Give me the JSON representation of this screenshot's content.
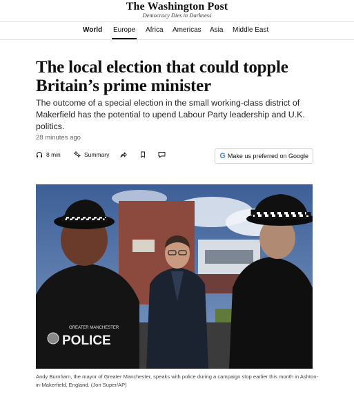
{
  "masthead": {
    "logo": "The Washington Post",
    "tagline": "Democracy Dies in Darkness"
  },
  "nav": {
    "items": [
      {
        "label": "World",
        "bold": true,
        "active": false
      },
      {
        "label": "Europe",
        "bold": false,
        "active": true
      },
      {
        "label": "Africa",
        "bold": false,
        "active": false
      },
      {
        "label": "Americas",
        "bold": false,
        "active": false
      },
      {
        "label": "Asia",
        "bold": false,
        "active": false
      },
      {
        "label": "Middle East",
        "bold": false,
        "active": false
      }
    ]
  },
  "article": {
    "headline": "The local election that could topple Britain’s prime minister",
    "dek": "The outcome of a special election in the small working-class district of Makerfield has the potential to upend Labour Party leadership and U.K. politics.",
    "timestamp": "28 minutes ago",
    "tools": {
      "listen_label": "8 min",
      "summary_label": "Summary",
      "share_icon": "share-icon",
      "save_icon": "bookmark-icon",
      "comments_icon": "comment-icon",
      "google_label": "Make us preferred on Google",
      "google_logo": "G"
    },
    "photo": {
      "vest_text_small": "GREATER MANCHESTER",
      "vest_text_large": "POLICE"
    },
    "caption": "Andy Burnham, the mayor of Greater Manchester, speaks with police during a campaign stop earlier this month in Ashton-in-Makerfield, England. (Jon Super/AP)"
  },
  "colors": {
    "text": "#111111",
    "rule": "#e3e3e3",
    "sky": "#4a6c9e",
    "google_blue": "#4285F4"
  }
}
